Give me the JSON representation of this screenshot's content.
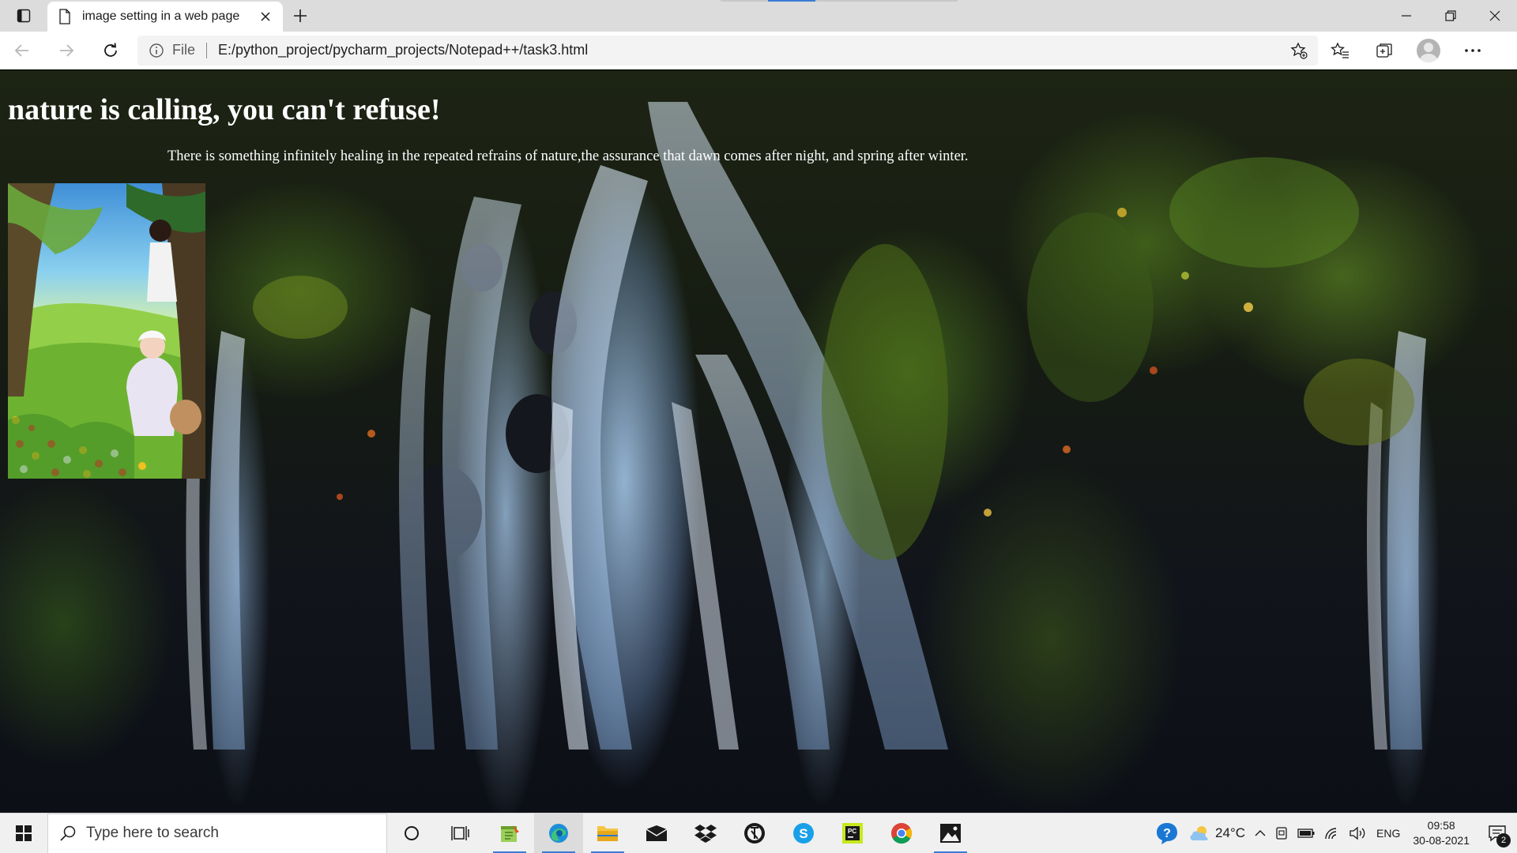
{
  "browser": {
    "tab": {
      "title": "image setting in a web page",
      "icon": "page-icon"
    },
    "address": {
      "scheme": "File",
      "url": "E:/python_project/pycharm_projects/Notepad++/task3.html"
    },
    "toolbar_icons": [
      "back-icon",
      "forward-icon",
      "refresh-icon",
      "add-favorite-icon",
      "favorites-icon",
      "collections-icon",
      "profile-avatar",
      "more-icon"
    ],
    "window_controls": [
      "minimize-icon",
      "restore-icon",
      "close-icon"
    ]
  },
  "page": {
    "heading": "nature is calling, you can't refuse!",
    "quote": "There is something infinitely healing in the repeated refrains of nature,the assurance that dawn comes after night, and spring after winter.",
    "background_image": "waterfall-forest",
    "inline_image": "girl-in-meadow-cartoon"
  },
  "taskbar": {
    "search_placeholder": "Type here to search",
    "apps": [
      "cortana-icon",
      "task-view-icon",
      "notepad-plus-plus-icon",
      "edge-icon",
      "file-explorer-icon",
      "mail-icon",
      "dropbox-icon",
      "steam-icon",
      "skype-icon",
      "pycharm-icon",
      "chrome-icon",
      "photos-icon"
    ],
    "tray": {
      "temperature": "24°C",
      "language": "ENG",
      "time": "09:58",
      "date": "30-08-2021",
      "notification_count": "2"
    }
  },
  "colors": {
    "tab_bar": "#dcdcdc",
    "address_bar": "#ffffff",
    "taskbar": "#f0f0f0",
    "accent": "#3a7bd5",
    "heading_text": "#ffffff"
  }
}
